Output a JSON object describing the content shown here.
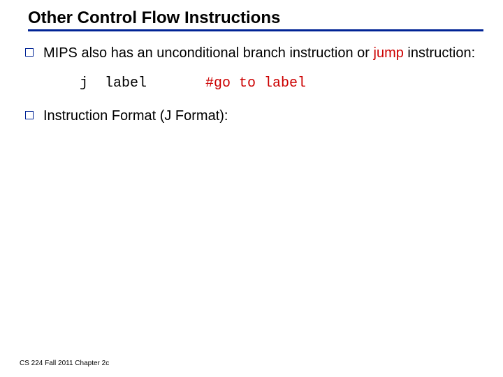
{
  "title": "Other Control Flow Instructions",
  "bullets": {
    "b1_pre": "MIPS also has an unconditional branch instruction or ",
    "b1_red": "jump",
    "b1_post": " instruction:",
    "b2": "Instruction Format (J Format):"
  },
  "code": {
    "instr": "j  label       ",
    "comment": "#go to label"
  },
  "footer": "CS 224 Fall 2011 Chapter 2c"
}
